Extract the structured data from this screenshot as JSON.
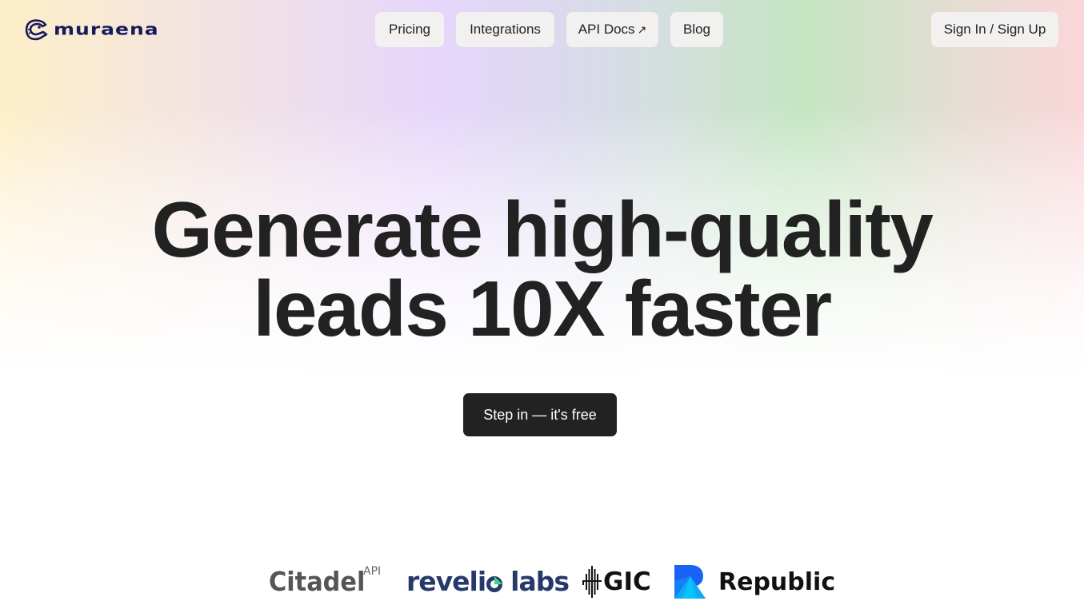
{
  "brand": {
    "name": "muraena",
    "logo_icon": "eel-icon",
    "color": "#16195a"
  },
  "nav": {
    "items": [
      {
        "label": "Pricing"
      },
      {
        "label": "Integrations"
      },
      {
        "label": "API Docs",
        "external_icon": "↗"
      },
      {
        "label": "Blog"
      }
    ],
    "auth_label": "Sign In / Sign Up"
  },
  "hero": {
    "headline_line1": "Generate high-quality",
    "headline_line2": "leads 10X faster",
    "cta_label": "Step in — it's free"
  },
  "clients": [
    {
      "name": "Citadel",
      "suffix": "API"
    },
    {
      "name": "revelio labs",
      "name_part1": "reveli",
      "name_part2": "labs"
    },
    {
      "name": "GIC"
    },
    {
      "name": "Republic"
    }
  ],
  "colors": {
    "text": "#222222",
    "button_bg": "#f2f1f0",
    "cta_bg": "#222222",
    "cta_text": "#ffffff",
    "gradient": [
      "#fdefc8",
      "#e6d6fb",
      "#c3e6c1",
      "#fbd6da"
    ]
  }
}
